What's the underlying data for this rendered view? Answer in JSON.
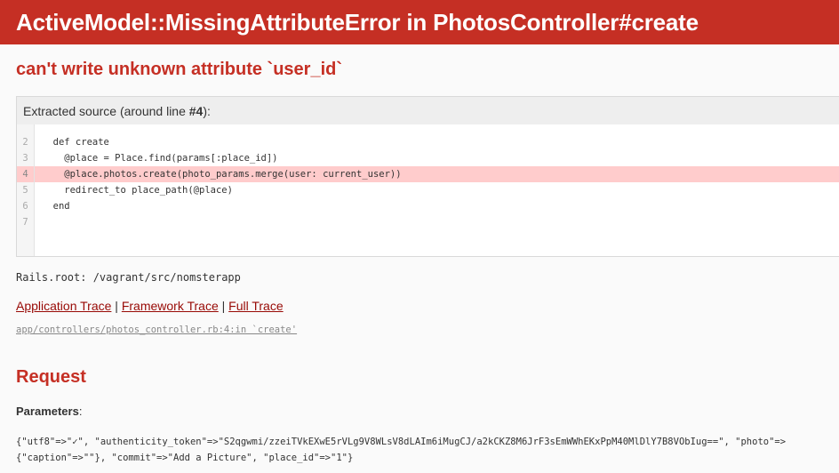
{
  "header": {
    "title": "ActiveModel::MissingAttributeError in PhotosController#create"
  },
  "error_message": "can't write unknown attribute `user_id`",
  "source": {
    "info_prefix": "Extracted source (around line ",
    "info_line": "#4",
    "info_suffix": "):",
    "line_numbers": [
      "2",
      "3",
      "4",
      "5",
      "6",
      "7"
    ],
    "lines": [
      "  def create",
      "    @place = Place.find(params[:place_id])",
      "    @place.photos.create(photo_params.merge(user: current_user))",
      "    redirect_to place_path(@place)",
      "  end",
      ""
    ],
    "highlighted_index": 2
  },
  "rails_root": "Rails.root: /vagrant/src/nomsterapp",
  "traces": {
    "application": "Application Trace",
    "framework": "Framework Trace",
    "full": "Full Trace",
    "separator": "|"
  },
  "trace_line": "app/controllers/photos_controller.rb:4:in `create'",
  "request": {
    "heading": "Request",
    "parameters_label": "Parameters",
    "parameters_colon": ":",
    "parameters_line1": "{\"utf8\"=>\"✓\", \"authenticity_token\"=>\"S2qgwmi/zzeiTVkEXwE5rVLg9V8WLsV8dLAIm6iMugCJ/a2kCKZ8M6JrF3sEmWWhEKxPpM40MlDlY7B8VObIug==\", \"photo\"=>",
    "parameters_line2": "{\"caption\"=>\"\"}, \"commit\"=>\"Add a Picture\", \"place_id\"=>\"1\"}"
  }
}
